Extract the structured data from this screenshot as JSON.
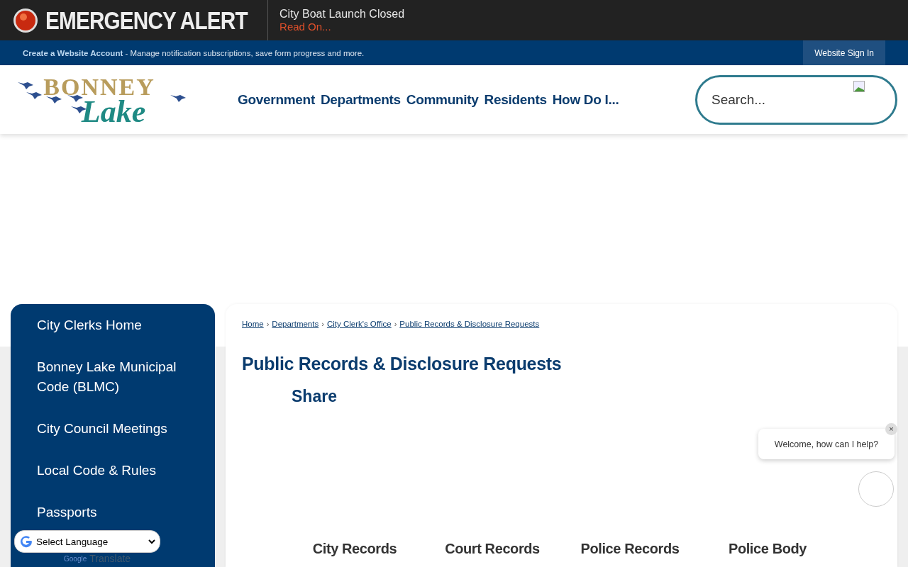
{
  "alert": {
    "label": "EMERGENCY ALERT",
    "title": "City Boat Launch Closed",
    "link": "Read On..."
  },
  "account_bar": {
    "link": "Create a Website Account",
    "text": " - Manage notification subscriptions, save form progress and more.",
    "sign_in": "Website Sign In"
  },
  "logo": {
    "top": "BONNEY",
    "bottom": "Lake"
  },
  "nav": [
    "Government",
    "Departments",
    "Community",
    "Residents",
    "How Do I..."
  ],
  "search": {
    "placeholder": "Search..."
  },
  "sidebar": {
    "items": [
      {
        "label": "City Clerks Home"
      },
      {
        "label": "Bonney Lake Municipal Code (BLMC)"
      },
      {
        "label": "City Council Meetings"
      },
      {
        "label": "Local Code & Rules"
      },
      {
        "label": "Passports"
      }
    ]
  },
  "breadcrumbs": [
    "Home",
    "Departments",
    "City Clerk's Office",
    "Public Records & Disclosure Requests"
  ],
  "breadcrumb_separator": "›",
  "page_title": "Public Records & Disclosure Requests",
  "share": "Share",
  "record_links": [
    "City Records",
    "Court Records",
    "Police Records",
    "Police Body"
  ],
  "chat": {
    "message": "Welcome, how can I help?",
    "close": "×"
  },
  "translate": {
    "select": "Select Language",
    "brand": "Google",
    "action": "Translate"
  }
}
